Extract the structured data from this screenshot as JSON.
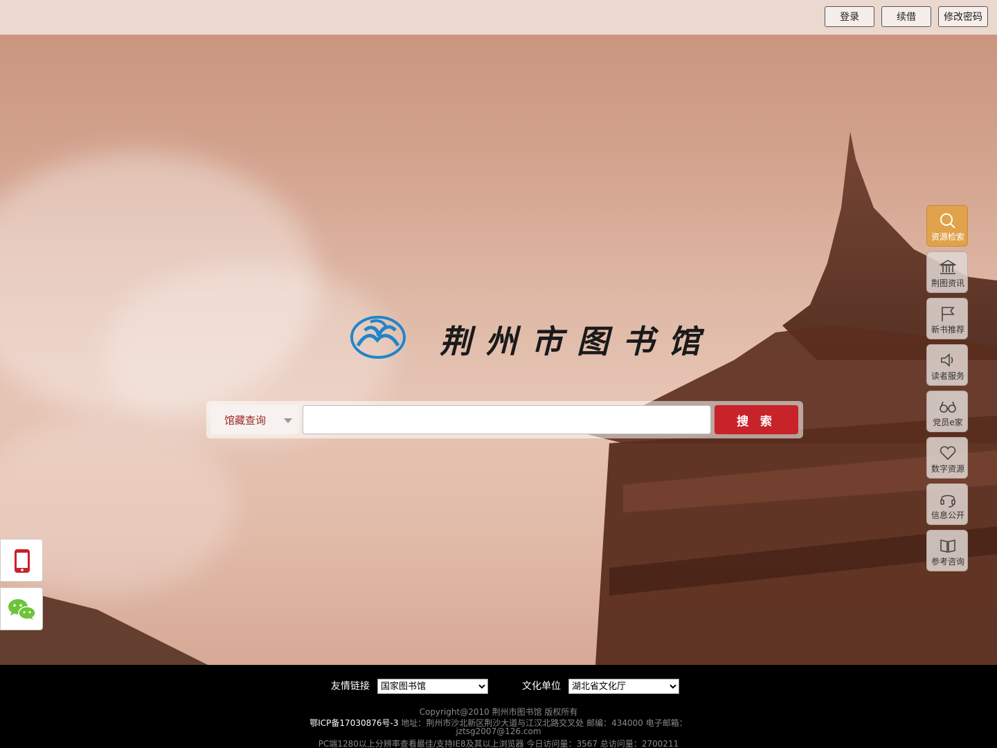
{
  "topbar": {
    "login_label": "登录",
    "renew_label": "续借",
    "change_password_label": "修改密码"
  },
  "logo": {
    "text": "荆州市图书馆"
  },
  "search": {
    "type_selected": "馆藏查询",
    "input_value": "",
    "button_label": "搜 索",
    "button_color": "#c8222a"
  },
  "side_nav": {
    "items": [
      {
        "label": "资源检索",
        "icon": "search-icon",
        "active": true
      },
      {
        "label": "荆图资讯",
        "icon": "library-building-icon",
        "active": false
      },
      {
        "label": "新书推荐",
        "icon": "flag-icon",
        "active": false
      },
      {
        "label": "读者服务",
        "icon": "speaker-icon",
        "active": false
      },
      {
        "label": "党员e家",
        "icon": "glasses-icon",
        "active": false
      },
      {
        "label": "数字资源",
        "icon": "heart-icon",
        "active": false
      },
      {
        "label": "信息公开",
        "icon": "headset-icon",
        "active": false
      },
      {
        "label": "参考咨询",
        "icon": "book-icon",
        "active": false
      }
    ],
    "active_color": "#e0a24a"
  },
  "floating": {
    "mobile_icon": "mobile-phone-icon",
    "wechat_icon": "wechat-icon"
  },
  "footer": {
    "friend_links_label": "友情链接",
    "friend_links_selected": "国家图书馆",
    "culture_units_label": "文化单位",
    "culture_units_selected": "湖北省文化厅",
    "copyright": "Copyright@2010 荆州市图书馆 版权所有",
    "icp": "鄂ICP备17030876号-3",
    "address": " 地址：荆州市沙北新区荆沙大道与江汉北路交叉处 邮编：434000 电子邮箱：",
    "email": "jztsg2007@126.com",
    "browser_note": "PC端1280以上分辨率查看最佳/支持IE8及其以上浏览器 今日访问量：3567 总访问量：2700211"
  }
}
